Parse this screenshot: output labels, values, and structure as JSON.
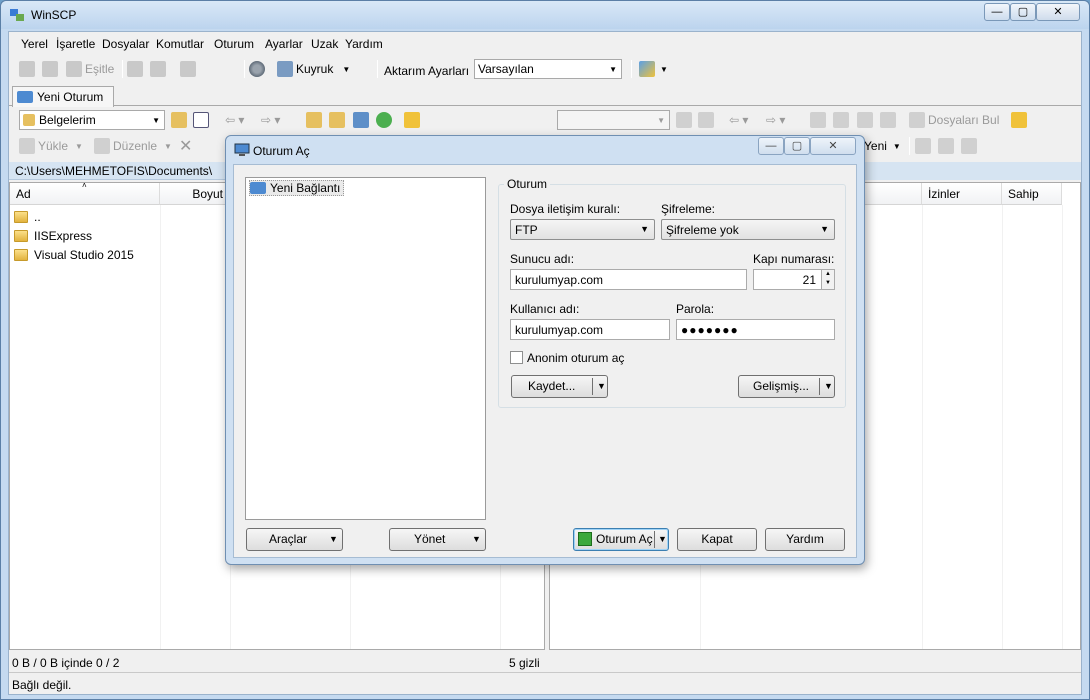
{
  "window": {
    "title": "WinSCP",
    "min": "—",
    "max": "▢",
    "close": "✕"
  },
  "menu": [
    "Yerel",
    "İşaretle",
    "Dosyalar",
    "Komutlar",
    "Oturum",
    "Ayarlar",
    "Uzak",
    "Yardım"
  ],
  "toolbar1": {
    "sync": "Eşitle",
    "queue": "Kuyruk",
    "transfer_label": "Aktarım Ayarları",
    "transfer_value": "Varsayılan"
  },
  "tab": {
    "label": "Yeni Oturum"
  },
  "local": {
    "drive": "Belgelerim",
    "upload": "Yükle",
    "edit": "Düzenle",
    "path": "C:\\Users\\MEHMETOFIS\\Documents\\",
    "columns": {
      "name": "Ad",
      "size": "Boyut"
    },
    "files": [
      "..",
      "IISExpress",
      "Visual Studio 2015"
    ]
  },
  "remote": {
    "find": "Dosyaları Bul",
    "new": "Yeni",
    "columns": {
      "perms": "İzinler",
      "owner": "Sahip"
    }
  },
  "status": {
    "selection": "0 B / 0 B içinde 0 / 2",
    "hidden": "5 gizli",
    "connection": "Bağlı değil."
  },
  "dialog": {
    "title": "Oturum Aç",
    "tree_item": "Yeni Bağlantı",
    "group": "Oturum",
    "protocol_label": "Dosya iletişim kuralı:",
    "protocol_value": "FTP",
    "encryption_label": "Şifreleme:",
    "encryption_value": "Şifreleme yok",
    "host_label": "Sunucu adı:",
    "host_value": "kurulumyap.com",
    "port_label": "Kapı numarası:",
    "port_value": "21",
    "user_label": "Kullanıcı adı:",
    "user_value": "kurulumyap.com",
    "pass_label": "Parola:",
    "pass_value": "●●●●●●●",
    "anon_label": "Anonim oturum aç",
    "save": "Kaydet...",
    "advanced": "Gelişmiş...",
    "tools": "Araçlar",
    "manage": "Yönet",
    "login": "Oturum Aç",
    "close": "Kapat",
    "help": "Yardım"
  }
}
